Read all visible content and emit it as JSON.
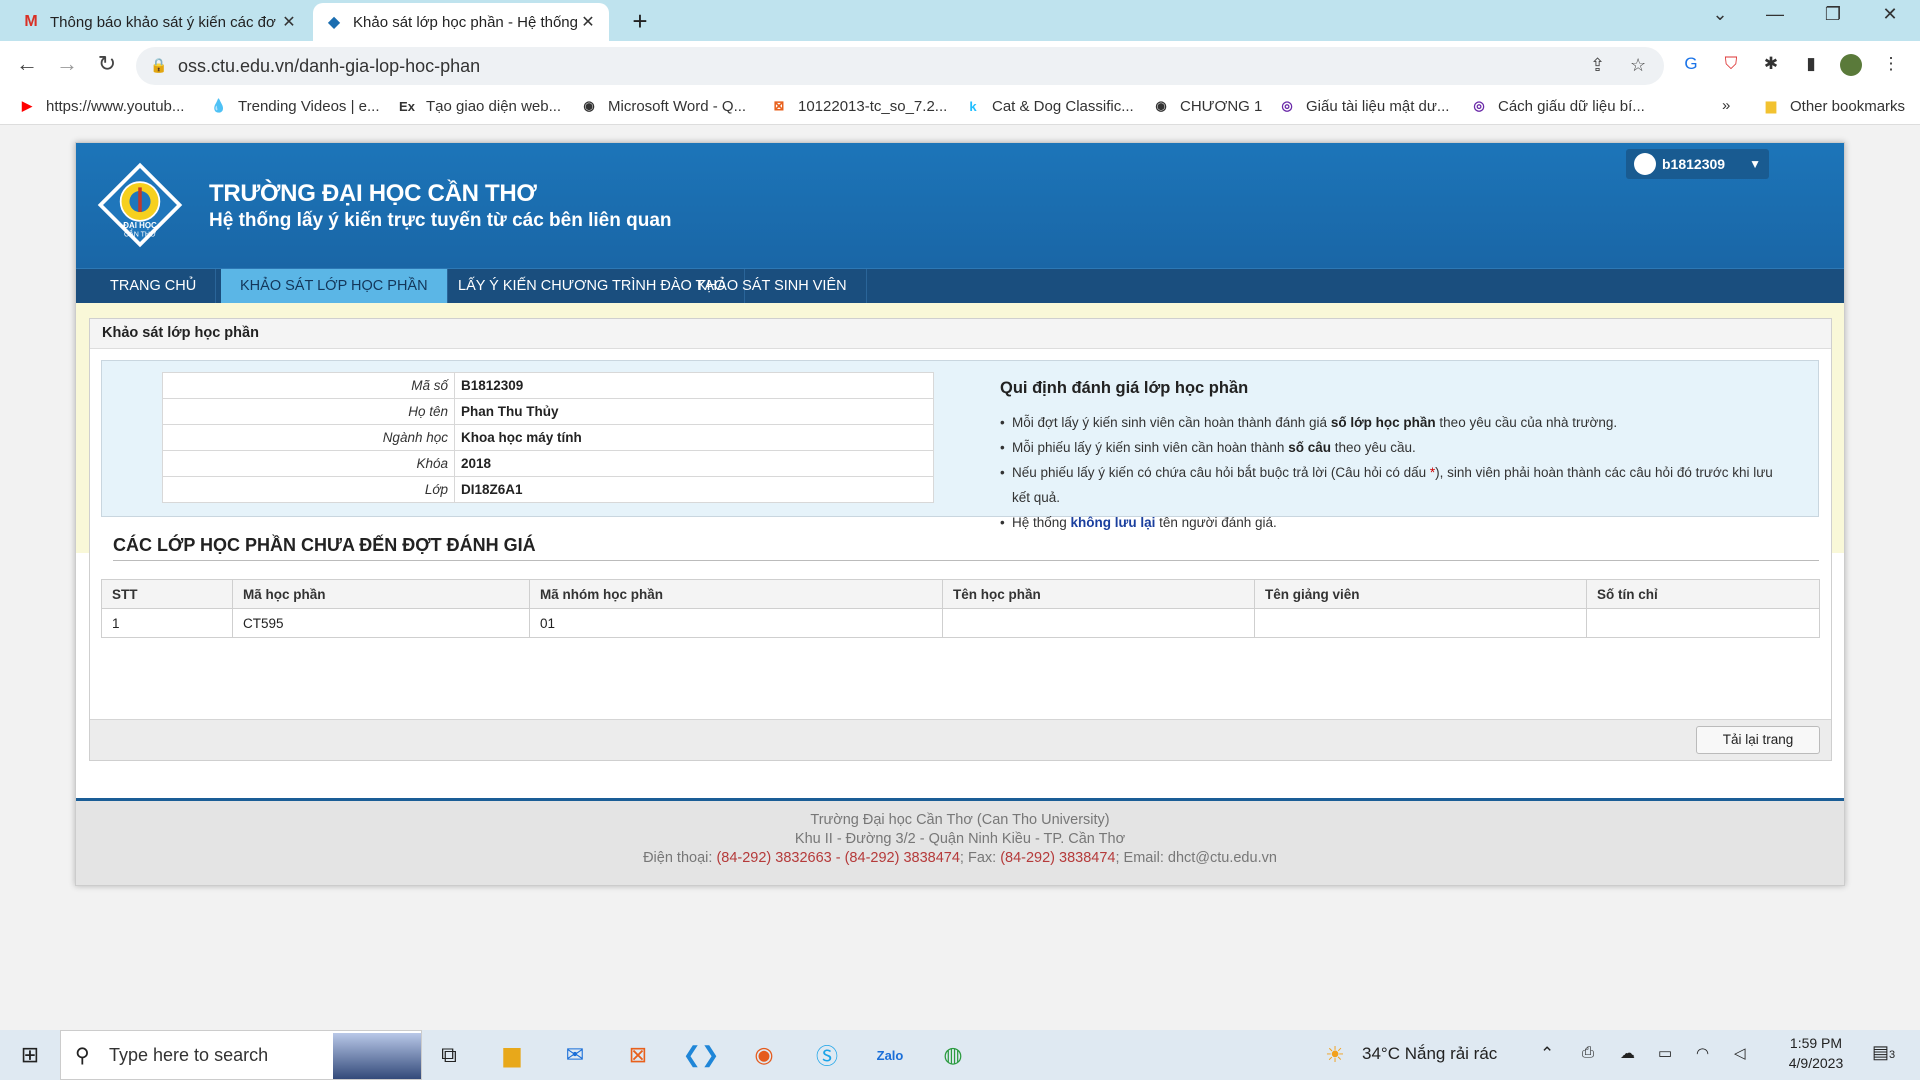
{
  "browser": {
    "tabs": [
      {
        "title": "Thông báo khảo sát ý kiến các đơ",
        "icon": "gmail-icon"
      },
      {
        "title": "Khảo sát lớp học phần - Hệ thống",
        "icon": "ctu-icon"
      }
    ],
    "url": "oss.ctu.edu.vn/danh-gia-lop-hoc-phan",
    "bookmarks": [
      "https://www.youtub...",
      "Trending Videos | e...",
      "Tạo giao diện web...",
      "Microsoft Word - Q...",
      "10122013-tc_so_7.2...",
      "Cat & Dog Classific...",
      "CHƯƠNG 1",
      "Giấu tài liệu mật dư...",
      "Cách giấu dữ liệu bí..."
    ],
    "other_bookmarks": "Other bookmarks"
  },
  "header": {
    "university": "TRƯỜNG ĐẠI HỌC CẦN THƠ",
    "subtitle": "Hệ thống lấy ý kiến trực tuyến từ các bên liên quan",
    "username": "b1812309",
    "logo_text_top": "ĐẠI HỌC",
    "logo_text_bottom": "CẦN THƠ"
  },
  "menu": [
    "TRANG CHỦ",
    "KHẢO SÁT LỚP HỌC PHẦN",
    "LẤY Ý KIẾN CHƯƠNG TRÌNH ĐÀO TẠO",
    "KHẢO SÁT SINH VIÊN"
  ],
  "panel": {
    "title": "Khảo sát lớp học phần",
    "student": [
      {
        "label": "Mã số",
        "value": "B1812309"
      },
      {
        "label": "Họ tên",
        "value": "Phan Thu Thủy"
      },
      {
        "label": "Ngành học",
        "value": "Khoa học máy tính"
      },
      {
        "label": "Khóa",
        "value": "2018"
      },
      {
        "label": "Lớp",
        "value": "DI18Z6A1"
      }
    ],
    "rules_title": "Qui định đánh giá lớp học phần",
    "rules": {
      "r1_a": "Mỗi đợt lấy ý kiến sinh viên cần hoàn thành đánh giá ",
      "r1_b": "số lớp học phần",
      "r1_c": " theo yêu cầu của nhà trường.",
      "r2_a": "Mỗi phiếu lấy ý kiến sinh viên cần hoàn thành ",
      "r2_b": "số câu",
      "r2_c": " theo yêu cầu.",
      "r3_a": "Nếu phiếu lấy ý kiến có chứa câu hỏi bắt buộc trả lời (Câu hỏi có dấu ",
      "r3_star": "*",
      "r3_b": "), sinh viên phải hoàn thành các câu hỏi đó trước khi lưu kết quả.",
      "r4_a": "Hệ thống ",
      "r4_b": "không lưu lại",
      "r4_c": " tên người đánh giá."
    },
    "section_title": "CÁC LỚP HỌC PHẦN CHƯA ĐẾN ĐỢT ĐÁNH GIÁ",
    "columns": [
      "STT",
      "Mã học phần",
      "Mã nhóm học phần",
      "Tên học phần",
      "Tên giảng viên",
      "Số tín chỉ"
    ],
    "rows": [
      [
        "1",
        "CT595",
        "01",
        "",
        "",
        ""
      ]
    ],
    "reload": "Tải lại trang"
  },
  "footer": {
    "line1": "Trường Đại học Cần Thơ (Can Tho University)",
    "line2": "Khu II - Đường 3/2 - Quận Ninh Kiều - TP. Cần Thơ",
    "phone_label": "Điện thoại: ",
    "phone": "(84-292) 3832663 - (84-292) 3838474",
    "fax_label": "; Fax: ",
    "fax": "(84-292) 3838474",
    "email_label": "; Email: ",
    "email": "dhct@ctu.edu.vn"
  },
  "taskbar": {
    "search_placeholder": "Type here to search",
    "weather": "34°C  Nắng rải rác",
    "time": "1:59 PM",
    "date": "4/9/2023",
    "notifications": "3"
  }
}
